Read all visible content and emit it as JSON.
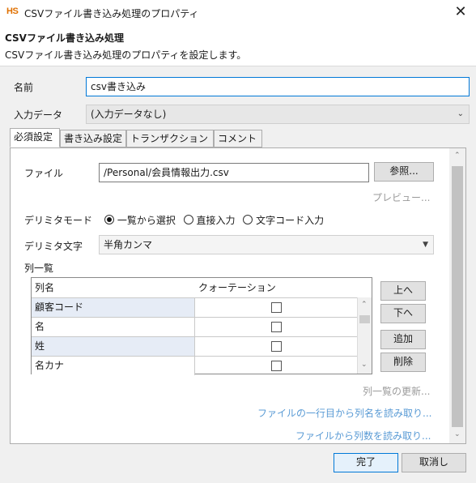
{
  "window": {
    "logo": "HS",
    "title": "CSVファイル書き込み処理のプロパティ",
    "close_glyph": "✕"
  },
  "header": {
    "title": "CSVファイル書き込み処理",
    "description": "CSVファイル書き込み処理のプロパティを設定します。"
  },
  "form": {
    "name_label": "名前",
    "name_value": "csv書き込み",
    "input_data_label": "入力データ",
    "input_data_value": "(入力データなし)"
  },
  "tabs": [
    {
      "label": "必須設定",
      "active": true
    },
    {
      "label": "書き込み設定",
      "active": false
    },
    {
      "label": "トランザクション",
      "active": false
    },
    {
      "label": "コメント",
      "active": false
    }
  ],
  "required": {
    "file_label": "ファイル",
    "file_value": "/Personal/会員情報出力.csv",
    "browse_label": "参照...",
    "preview_label": "プレビュー...",
    "delimiter_mode_label": "デリミタモード",
    "delimiter_modes": [
      {
        "label": "一覧から選択",
        "selected": true
      },
      {
        "label": "直接入力",
        "selected": false
      },
      {
        "label": "文字コード入力",
        "selected": false
      }
    ],
    "delimiter_char_label": "デリミタ文字",
    "delimiter_char_value": "半角カンマ",
    "column_list_label": "列一覧",
    "columns_header": [
      "列名",
      "クォーテーション"
    ],
    "columns": [
      {
        "name": "顧客コード",
        "quote": false
      },
      {
        "name": "名",
        "quote": false
      },
      {
        "name": "姓",
        "quote": false
      },
      {
        "name": "名カナ",
        "quote": false
      }
    ],
    "up_label": "上へ",
    "down_label": "下へ",
    "add_label": "追加",
    "delete_label": "削除",
    "refresh_link": "列一覧の更新...",
    "read_header_link": "ファイルの一行目から列名を読み取り...",
    "read_count_link": "ファイルから列数を読み取り..."
  },
  "footer": {
    "ok_label": "完了",
    "cancel_label": "取消し"
  },
  "colors": {
    "accent": "#0078d7",
    "link": "#5a9bd5",
    "logo": "#e07000",
    "row_highlight": "#e6ecf6"
  },
  "icons": {
    "close": "close-icon",
    "dropdown": "chevron-down-icon",
    "scroll_up": "chevron-up-icon",
    "scroll_down": "chevron-down-icon"
  }
}
